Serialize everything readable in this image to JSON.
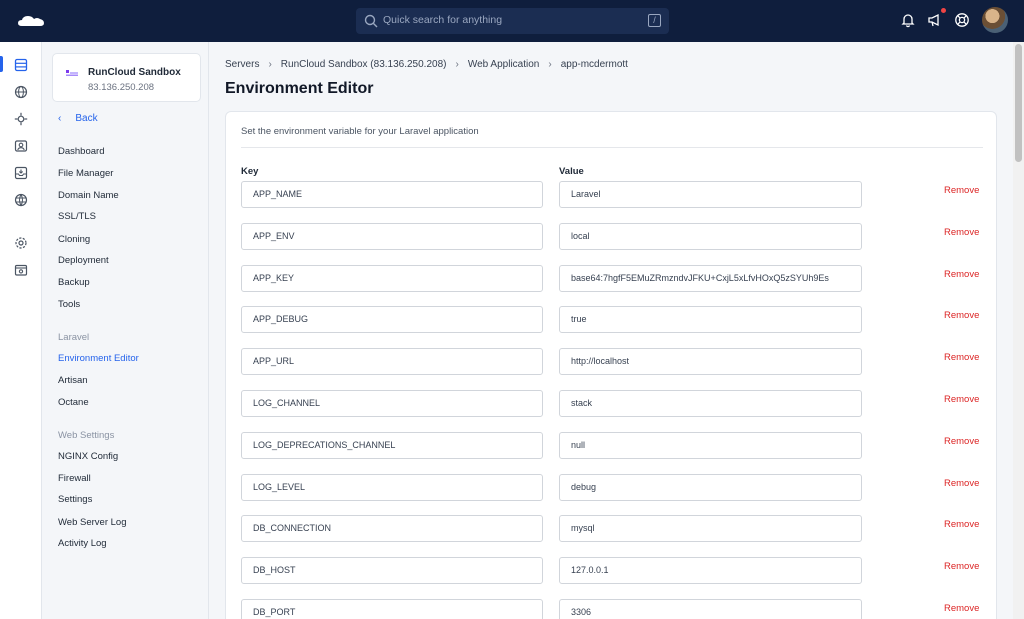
{
  "topbar": {
    "search_placeholder": "Quick search for anything",
    "search_shortcut": "/"
  },
  "server": {
    "name": "RunCloud Sandbox",
    "ip": "83.136.250.208"
  },
  "sidebar": {
    "back_label": "Back",
    "items": [
      "Dashboard",
      "File Manager",
      "Domain Name",
      "SSL/TLS",
      "Cloning",
      "Deployment",
      "Backup",
      "Tools"
    ],
    "laravel_heading": "Laravel",
    "laravel_items": [
      "Environment Editor",
      "Artisan",
      "Octane"
    ],
    "web_heading": "Web Settings",
    "web_items": [
      "NGINX Config",
      "Firewall",
      "Settings",
      "Web Server Log",
      "Activity Log"
    ]
  },
  "breadcrumb": [
    "Servers",
    "RunCloud Sandbox (83.136.250.208)",
    "Web Application",
    "app-mcdermott"
  ],
  "page_title": "Environment Editor",
  "editor": {
    "description": "Set the environment variable for your Laravel application",
    "key_header": "Key",
    "value_header": "Value",
    "remove_label": "Remove",
    "rows": [
      {
        "key": "APP_NAME",
        "value": "Laravel"
      },
      {
        "key": "APP_ENV",
        "value": "local"
      },
      {
        "key": "APP_KEY",
        "value": "base64:7hgfF5EMuZRmzndvJFKU+CxjL5xLfvHOxQ5zSYUh9Es"
      },
      {
        "key": "APP_DEBUG",
        "value": "true"
      },
      {
        "key": "APP_URL",
        "value": "http://localhost"
      },
      {
        "key": "LOG_CHANNEL",
        "value": "stack"
      },
      {
        "key": "LOG_DEPRECATIONS_CHANNEL",
        "value": "null"
      },
      {
        "key": "LOG_LEVEL",
        "value": "debug"
      },
      {
        "key": "DB_CONNECTION",
        "value": "mysql"
      },
      {
        "key": "DB_HOST",
        "value": "127.0.0.1"
      },
      {
        "key": "DB_PORT",
        "value": "3306"
      }
    ]
  },
  "colors": {
    "topbar": "#0f1e3d",
    "accent": "#2563eb",
    "remove": "#dc2626"
  }
}
